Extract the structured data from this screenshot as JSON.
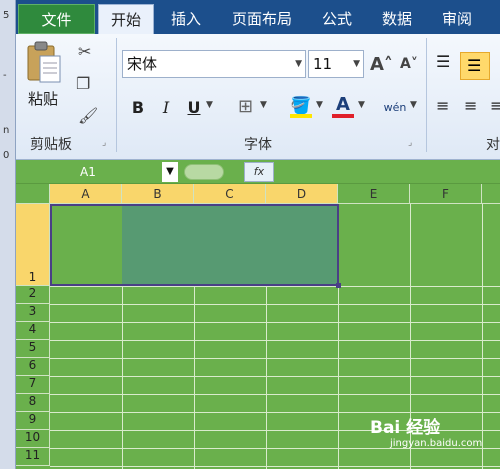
{
  "tabs": [
    {
      "label": "文件"
    },
    {
      "label": "开始"
    },
    {
      "label": "插入"
    },
    {
      "label": "页面布局"
    },
    {
      "label": "公式"
    },
    {
      "label": "数据"
    },
    {
      "label": "审阅"
    }
  ],
  "clipboard": {
    "paste_label": "粘贴",
    "group_label": "剪贴板"
  },
  "font": {
    "font_name": "宋体",
    "font_size": "11",
    "group_label": "字体",
    "bold": "B",
    "italic": "I",
    "underline": "U",
    "phonetic": "wén"
  },
  "alignment": {
    "group_label": "对"
  },
  "formula_bar": {
    "name_box": "A1",
    "fx": "fx"
  },
  "grid": {
    "columns": [
      "A",
      "B",
      "C",
      "D",
      "E",
      "F"
    ],
    "rows": [
      "1",
      "2",
      "3",
      "4",
      "5",
      "6",
      "7",
      "8",
      "9",
      "10",
      "11"
    ],
    "selected_range": "A1:D1"
  },
  "watermark": {
    "text": "Bai 经验",
    "url": "jingyan.baidu.com"
  },
  "colors": {
    "sheet_fill": "#6ab04c",
    "selection_fill": "#579a72",
    "header_highlight": "#f9d66b",
    "ribbon_tab_bar": "#1c4f8c",
    "file_tab": "#2f8a3d"
  }
}
